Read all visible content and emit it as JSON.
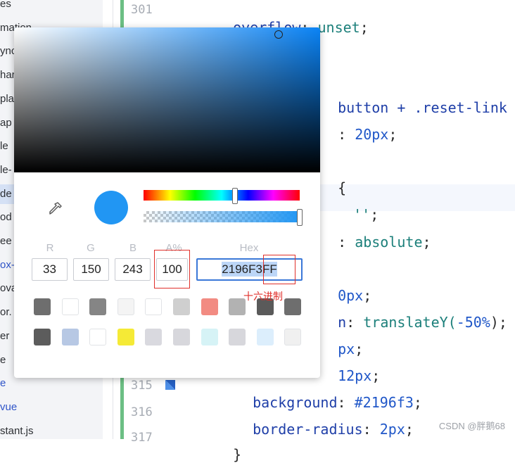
{
  "file_tree": {
    "items": [
      {
        "label": "es",
        "state": "normal"
      },
      {
        "label": "mation",
        "state": "normal"
      },
      {
        "label": "ync",
        "state": "normal"
      },
      {
        "label": "har",
        "state": "normal"
      },
      {
        "label": "pla",
        "state": "normal"
      },
      {
        "label": "ap",
        "state": "normal"
      },
      {
        "label": "le",
        "state": "normal"
      },
      {
        "label": "le-",
        "state": "normal"
      },
      {
        "label": "de",
        "state": "selected"
      },
      {
        "label": "od",
        "state": "normal"
      },
      {
        "label": "ee",
        "state": "normal"
      },
      {
        "label": "ox-",
        "state": "blue"
      },
      {
        "label": "ova",
        "state": "normal"
      },
      {
        "label": "or.",
        "state": "normal"
      },
      {
        "label": "er",
        "state": "normal"
      },
      {
        "label": "e",
        "state": "normal"
      },
      {
        "label": "e",
        "state": "blue"
      },
      {
        "label": "vue",
        "state": "blue"
      },
      {
        "label": "stant.js",
        "state": "normal"
      }
    ]
  },
  "editor": {
    "line_numbers": [
      "301",
      "315",
      "316",
      "317"
    ],
    "lines": {
      "l301": {
        "prop": "overflow",
        "sep": ": ",
        "val": "unset",
        "end": ";"
      },
      "l304_tail": "button + .reset-link",
      "l305_tail": {
        "sep": ": ",
        "num": "20px",
        "end": ";"
      },
      "l307_tail": "{",
      "l308_tail": {
        "str": "''",
        "end": ";"
      },
      "l309_tail": {
        "sep": ": ",
        "val": "absolute",
        "end": ";"
      },
      "l311_tail": {
        "num": "0px",
        "end": ";"
      },
      "l312_tail": {
        "prop": "n",
        "sep": ": ",
        "val": "translateY(",
        "num": "-50%",
        "end": ");"
      },
      "l313_tail": {
        "num": "px",
        "end": ";"
      },
      "l314_tail": {
        "num": "12px",
        "end": ";"
      },
      "l315": {
        "prop": "background",
        "sep": ": ",
        "val": "#2196f3",
        "end": ";"
      },
      "l316": {
        "prop": "border-radius",
        "sep": ": ",
        "num": "2px",
        "end": ";"
      },
      "l317": "}"
    }
  },
  "color_picker": {
    "current_color": "#2196f3",
    "labels": {
      "r": "R",
      "g": "G",
      "b": "B",
      "a": "A%",
      "hex": "Hex"
    },
    "values": {
      "r": "33",
      "g": "150",
      "b": "243",
      "a": "100",
      "hex": "2196F3FF"
    },
    "hue_level": 0.58,
    "alpha_level": 1.0,
    "swatches_row1": [
      "#6e6e6e",
      "#ffffff",
      "#858585",
      "#f4f4f4",
      "#ffffff",
      "#cfcfcf",
      "#f28b82",
      "#b2b2b2",
      "#5a5a5a",
      "#6e6e6e"
    ],
    "swatches_row2": [
      "#5c5c5c",
      "#b7c8e4",
      "#ffffff",
      "#f5ea36",
      "#d9d9df",
      "#d7d7dc",
      "#d6f3f6",
      "#d7d7dc",
      "#dceefc",
      "#f0f0f0"
    ]
  },
  "annotation": {
    "note_text": "十六进制",
    "color": "#e0302b"
  },
  "watermark": "CSDN @胖鹅68"
}
